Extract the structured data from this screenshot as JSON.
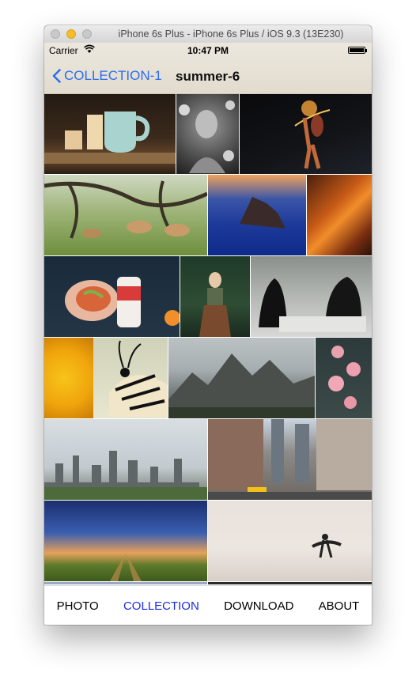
{
  "window": {
    "title": "iPhone 6s Plus - iPhone 6s Plus / iOS 9.3 (13E230)"
  },
  "status_bar": {
    "carrier": "Carrier",
    "time": "10:47 PM"
  },
  "nav": {
    "back_label": "COLLECTION-1",
    "title": "summer-6"
  },
  "tabs": [
    {
      "label": "PHOTO",
      "active": false
    },
    {
      "label": "COLLECTION",
      "active": true
    },
    {
      "label": "DOWNLOAD",
      "active": false
    },
    {
      "label": "ABOUT",
      "active": false
    }
  ],
  "photos": [
    "mug-on-table-photo",
    "woman-with-flowers-photo",
    "fire-dancer-photo",
    "deer-in-meadow-photo",
    "sea-rock-at-sunset-photo",
    "orange-rock-texture-photo",
    "sandwich-and-can-photo",
    "woman-in-forest-photo",
    "hooded-figures-photo",
    "yellow-flower-photo",
    "butterfly-photo",
    "mountain-range-photo",
    "pink-blossoms-photo",
    "city-skyline-photo",
    "city-street-photo",
    "sunset-field-photo",
    "surfer-on-beach-photo"
  ],
  "colors": {
    "accent": "#2b6df2",
    "active_tab": "#1a2de0"
  }
}
